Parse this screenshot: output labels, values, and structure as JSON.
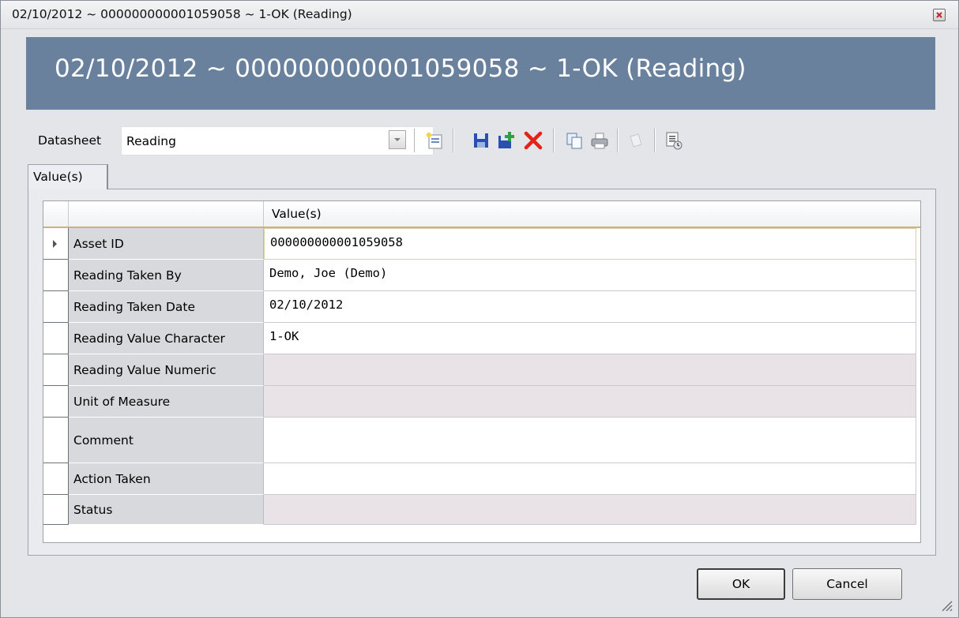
{
  "window": {
    "title": "02/10/2012 ~ 000000000001059058 ~ 1-OK (Reading)",
    "header_title": "02/10/2012 ~ 000000000001059058 ~ 1-OK (Reading)"
  },
  "toolbar": {
    "datasheet_label": "Datasheet",
    "datasheet_value": "Reading",
    "buttons": [
      "new-record-icon",
      "save-icon",
      "save-and-new-icon",
      "delete-icon",
      "copy-icon",
      "print-icon",
      "disabled-item-icon",
      "reports-icon"
    ]
  },
  "tabs": [
    {
      "label": "Value(s)",
      "active": true
    }
  ],
  "grid": {
    "columns": [
      "",
      "Value(s)"
    ],
    "rows": [
      {
        "label": "Asset ID",
        "value": "000000000001059058",
        "readonly": false,
        "current": true
      },
      {
        "label": "Reading Taken By",
        "value": "Demo, Joe (Demo)",
        "readonly": false
      },
      {
        "label": "Reading Taken Date",
        "value": "02/10/2012",
        "readonly": false
      },
      {
        "label": "Reading Value Character",
        "value": "1-OK",
        "readonly": false
      },
      {
        "label": "Reading Value Numeric",
        "value": "",
        "readonly": true
      },
      {
        "label": "Unit of Measure",
        "value": "",
        "readonly": true
      },
      {
        "label": "Comment",
        "value": "",
        "readonly": false
      },
      {
        "label": "Action Taken",
        "value": "",
        "readonly": false
      },
      {
        "label": "Status",
        "value": "",
        "readonly": true
      }
    ]
  },
  "footer": {
    "ok_label": "OK",
    "cancel_label": "Cancel"
  },
  "colors": {
    "header_band": "#6a819e",
    "readonly_cell": "#e9e2e6",
    "delete_red": "#e2231a",
    "save_blue": "#2a4fb0"
  }
}
